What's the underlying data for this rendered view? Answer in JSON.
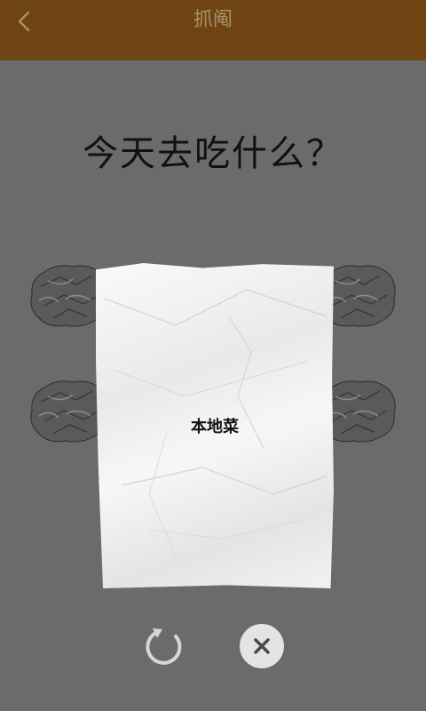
{
  "header": {
    "title": "抓阄",
    "back_icon": "chevron-left-icon",
    "background_color": "#6e4512",
    "title_color": "#a8906a"
  },
  "main": {
    "question": "今天去吃什么？",
    "background_color": "#6b6b6b",
    "paper": {
      "result_text": "本地菜"
    }
  },
  "actions": {
    "refresh_icon": "refresh-icon",
    "close_icon": "close-icon"
  }
}
